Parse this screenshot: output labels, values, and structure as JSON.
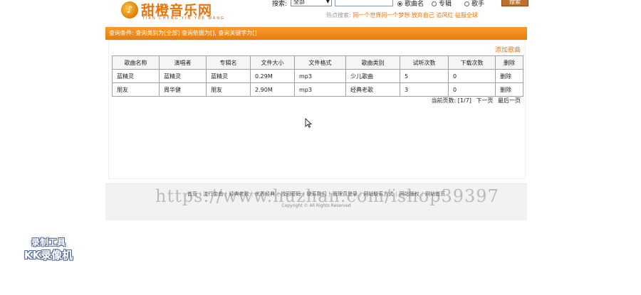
{
  "header": {
    "logo_text": "甜橙音乐网",
    "logo_sub": "TIAN CHENG YIN YUE WANG",
    "search_label": "搜索:",
    "search_select": "全部",
    "search_value": "",
    "radios": [
      "歌曲名",
      "专辑",
      "歌手"
    ],
    "selected_radio": "歌曲名",
    "search_button": "搜索",
    "hot_label": "热点搜索:",
    "hot_links": "同一个世界同一个梦想  放弃自己  追风红  征服全球"
  },
  "condition_bar": "查询条件: 查询类别为[全部] 查询依据为[], 查询关键字为[]",
  "add_song": "添加歌曲",
  "table": {
    "headers": [
      "歌曲名称",
      "演唱者",
      "专辑名",
      "文件大小",
      "文件格式",
      "歌曲类别",
      "试听次数",
      "下载次数",
      "删除"
    ],
    "rows": [
      [
        "蓝精灵",
        "蓝精灵",
        "蓝精灵",
        "0.29M",
        "mp3",
        "少儿歌曲",
        "5",
        "0",
        "删除"
      ],
      [
        "朋友",
        "周华健",
        "朋友",
        "2.90M",
        "mp3",
        "经典老歌",
        "3",
        "0",
        "删除"
      ]
    ]
  },
  "pager": {
    "label": "当前页数: [1/7]",
    "next": "下一页",
    "last": "最后一页"
  },
  "footer": {
    "links": [
      "首页",
      "流行金曲",
      "经典老歌",
      "优秀经典",
      "找回密码",
      "联系我们",
      "管理员登录",
      "网站联系方式",
      "网站版权",
      "网站首页"
    ],
    "copyright": "Copyright © All Rights Reserved"
  },
  "watermark": "https://www.huzhan.com/ishop39397",
  "recorder": {
    "line1": "录制工具",
    "line2": "KK录像机"
  }
}
